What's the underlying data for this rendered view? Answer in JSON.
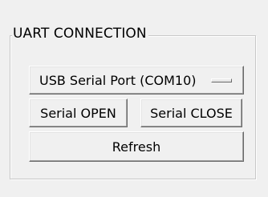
{
  "group": {
    "title": "UART CONNECTION"
  },
  "port_selector": {
    "label": "USB Serial Port (COM10)",
    "indicator_icon": "option-menu-indicator"
  },
  "buttons": {
    "open_label": "Serial OPEN",
    "close_label": "Serial CLOSE",
    "refresh_label": "Refresh"
  },
  "colors": {
    "background": "#f0f0f0",
    "text": "#000000"
  }
}
